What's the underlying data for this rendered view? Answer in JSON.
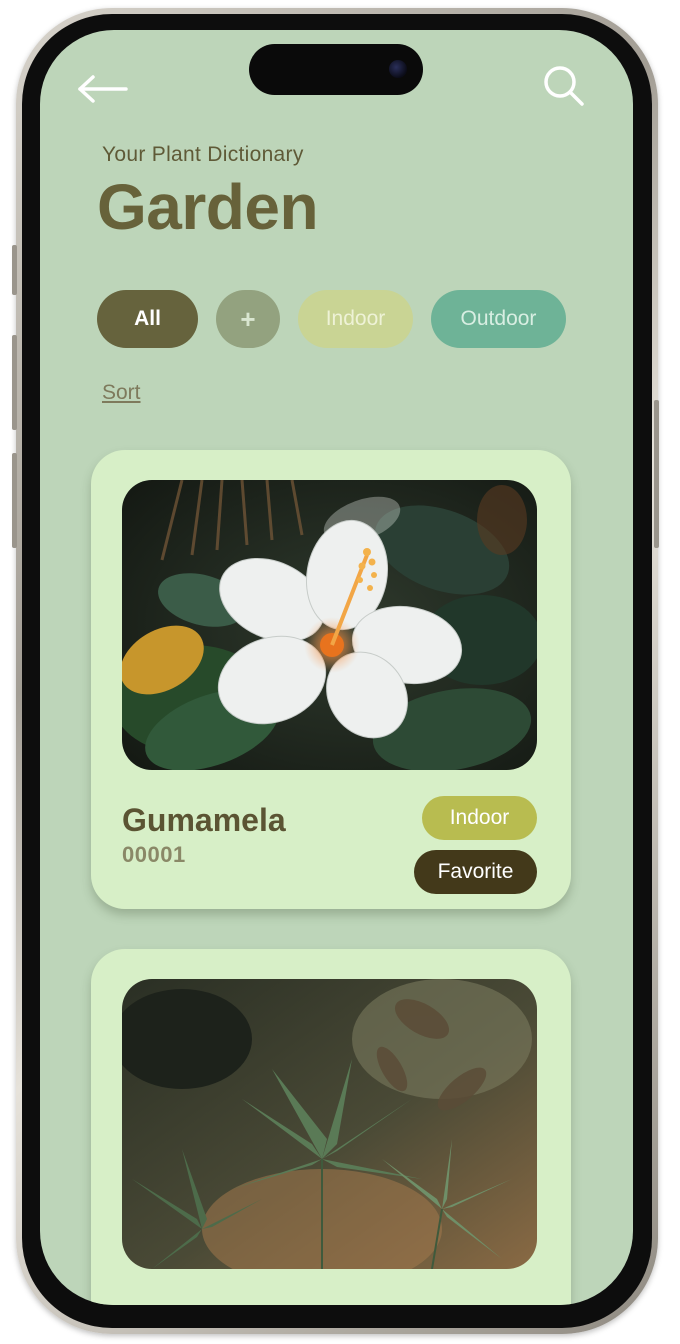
{
  "header": {
    "subtitle": "Your Plant Dictionary",
    "title": "Garden"
  },
  "filters": {
    "all_label": "All",
    "add_label": "+",
    "indoor_label": "Indoor",
    "outdoor_label": "Outdoor"
  },
  "sort_label": "Sort",
  "plants": [
    {
      "name": "Gumamela",
      "id": "00001",
      "tags": [
        "Indoor",
        "Favorite"
      ],
      "image": "white-hibiscus-flower-photo"
    },
    {
      "image": "green-leafy-plant-photo"
    }
  ],
  "icons": {
    "back": "back-arrow-icon",
    "search": "search-icon"
  },
  "colors": {
    "screen_bg": "#bdd5b9",
    "card_bg": "#d7efc7",
    "title": "#67623a",
    "chip_all": "#66633d",
    "chip_add": "#93a27f",
    "chip_indoor": "#c9d494",
    "chip_outdoor": "#6eb397",
    "badge_indoor": "#b8bc50",
    "badge_favorite": "#43391a"
  }
}
